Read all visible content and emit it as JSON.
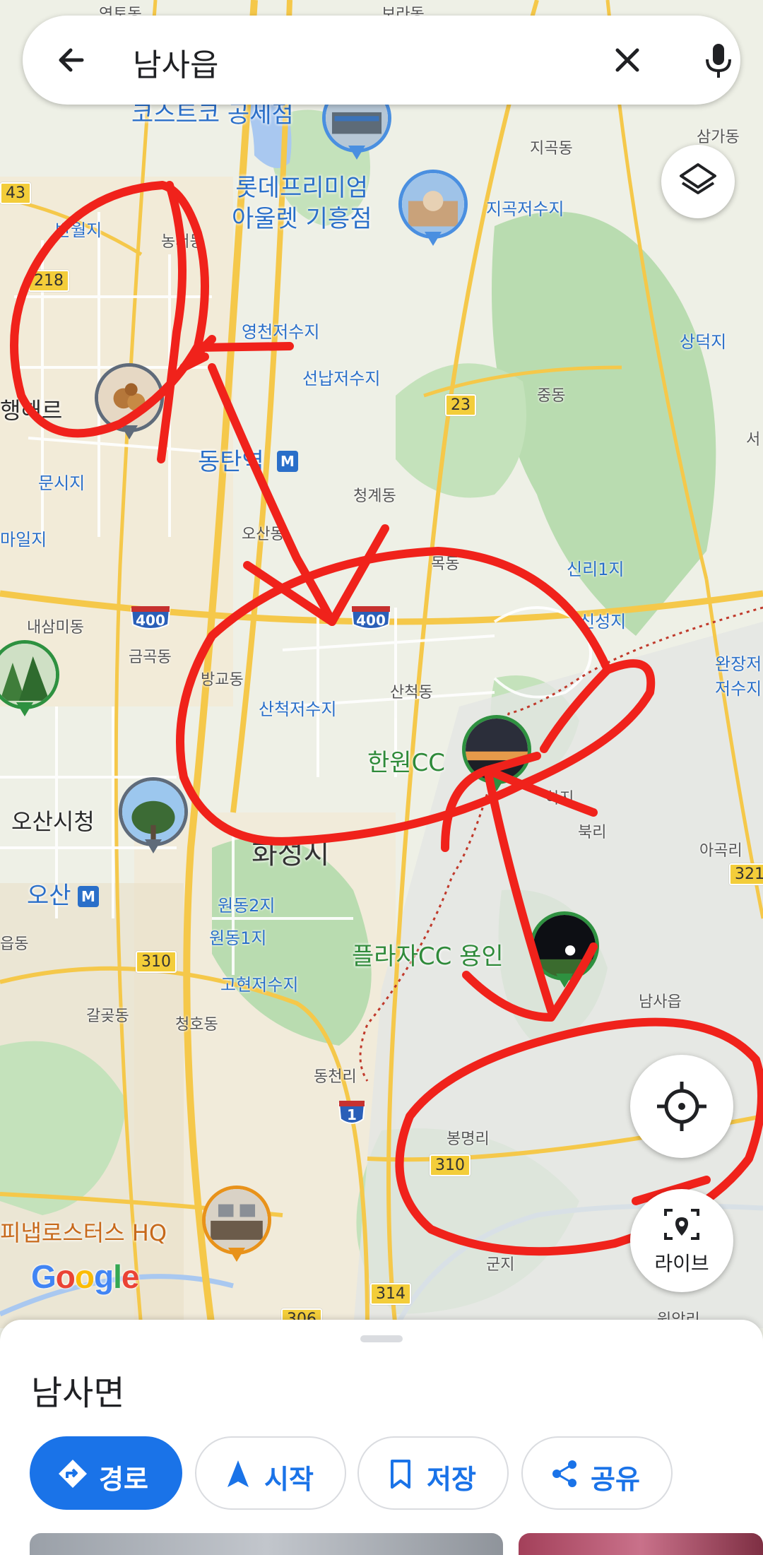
{
  "search": {
    "query": "남사읍"
  },
  "map": {
    "labels": {
      "top_left_partial": "연토동",
      "top_right_partial": "보라동",
      "top_costco_partial": "코스트코 공세점",
      "lotte_outlet": "롯데프리미엄\n아울렛 기흥점",
      "jigok_dong": "지곡동",
      "samga_dong": "삼가동",
      "jigok_reservoir": "지곡저수지",
      "banwol": "반월지",
      "nongseo": "농서동",
      "yeongcheon_reservoir": "영천저수지",
      "seonnap_reservoir": "선납저수지",
      "sangdeok": "상덕지",
      "jung_dong": "중동",
      "seo_partial": "서",
      "haengreu_partial": "행해르",
      "dongtan_station": "동탄역",
      "munsi": "문시지",
      "cheonggye": "청계동",
      "maeil_partial": "마일지",
      "osan_dong": "오산동",
      "mok_dong": "목동",
      "sinri1": "신리1지",
      "sinseong": "신성지",
      "naesammi": "내삼미동",
      "geumgok": "금곡동",
      "bangyo": "방교동",
      "sancheok_dong": "산척동",
      "sancheok_reservoir": "산척저수지",
      "wanjang_partial": "완장저\n저수지",
      "hanwon_cc": "한원CC",
      "hwaseong_city": "화성시",
      "osan_city_hall": "오산시청",
      "buk_ri": "북리",
      "ageok_ri": "아곡리",
      "osan": "오산",
      "wondong2": "원동2지",
      "wondong1": "원동1지",
      "eup_dong_partial": "읍동",
      "plaza_cc": "플라자CC 용인",
      "namsa_eup": "남사읍",
      "gohyeon_reservoir": "고현저수지",
      "galgot": "갈곶동",
      "cheongho": "청호동",
      "dongcheon_ri": "동천리",
      "bongmyeong_ri": "봉명리",
      "pinap_hq": "피냅로스터스 HQ",
      "gun_partial": "군지",
      "wonam_ri": "원암리",
      "haksan_partial": "하지"
    },
    "road_shields": [
      "218",
      "23",
      "310",
      "310",
      "314",
      "306",
      "321",
      "43"
    ],
    "highway_shields": [
      "400",
      "400",
      "1"
    ],
    "route_marks": [
      "M",
      "M"
    ]
  },
  "buttons": {
    "live_label": "라이브"
  },
  "attribution": {
    "logo_letters": [
      "G",
      "o",
      "o",
      "g",
      "l",
      "e"
    ]
  },
  "sheet": {
    "place_name": "남사면",
    "actions": {
      "route": "경로",
      "start": "시작",
      "save": "저장",
      "share": "공유"
    }
  },
  "colors": {
    "accent": "#1a73e8",
    "annotation": "#f0221b",
    "park_green": "#b9dcb0",
    "road_yellow": "#f5c84a"
  }
}
